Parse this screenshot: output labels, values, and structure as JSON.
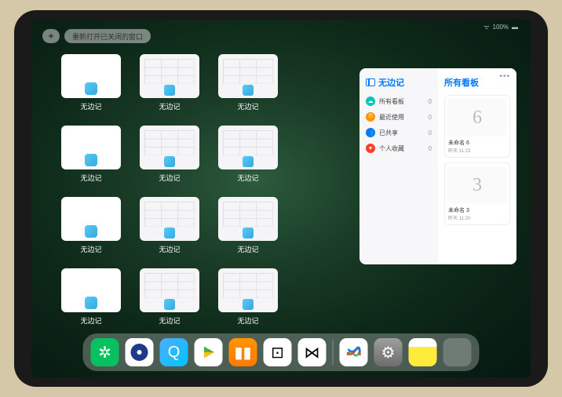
{
  "status": {
    "wifi": "⋮⋮",
    "battery": "100%"
  },
  "topbar": {
    "add_glyph": "+",
    "reopen_label": "重新打开已关闭的窗口"
  },
  "windows": {
    "label": "无边记",
    "items": [
      {
        "type": "blank"
      },
      {
        "type": "grid"
      },
      {
        "type": "grid"
      },
      {
        "type": "blank"
      },
      {
        "type": "grid"
      },
      {
        "type": "grid"
      },
      {
        "type": "blank"
      },
      {
        "type": "grid"
      },
      {
        "type": "grid"
      },
      {
        "type": "blank"
      },
      {
        "type": "grid"
      },
      {
        "type": "grid"
      }
    ]
  },
  "panel": {
    "left_title": "无边记",
    "right_title": "所有看板",
    "menu": [
      {
        "icon_color": "#00c7be",
        "glyph": "☁",
        "label": "所有看板",
        "count": "0"
      },
      {
        "icon_color": "#ff9500",
        "glyph": "⏱",
        "label": "最近使用",
        "count": "0"
      },
      {
        "icon_color": "#007aff",
        "glyph": "👥",
        "label": "已共享",
        "count": "0"
      },
      {
        "icon_color": "#ff3b30",
        "glyph": "♥",
        "label": "个人收藏",
        "count": "0"
      }
    ],
    "boards": [
      {
        "sketch": "6",
        "name": "未命名 6",
        "date": "昨天 11:23"
      },
      {
        "sketch": "3",
        "name": "未命名 3",
        "date": "昨天 11:20"
      }
    ]
  },
  "dock": {
    "icons": [
      {
        "name": "wechat",
        "class": "ic-wechat",
        "glyph": "✲"
      },
      {
        "name": "browser1",
        "class": "ic-q1",
        "glyph": ""
      },
      {
        "name": "browser2",
        "class": "ic-q2",
        "glyph": "Q"
      },
      {
        "name": "play",
        "class": "ic-play",
        "glyph": "▶"
      },
      {
        "name": "books",
        "class": "ic-books",
        "glyph": "▮▮"
      },
      {
        "name": "dice",
        "class": "ic-dice",
        "glyph": "⊡"
      },
      {
        "name": "connect",
        "class": "ic-dots",
        "glyph": "⋈"
      }
    ],
    "recent": [
      {
        "name": "freeform",
        "class": "ic-freeform",
        "glyph": "〰"
      },
      {
        "name": "settings",
        "class": "ic-settings",
        "glyph": "⚙"
      },
      {
        "name": "notes",
        "class": "ic-notes",
        "glyph": ""
      }
    ]
  }
}
